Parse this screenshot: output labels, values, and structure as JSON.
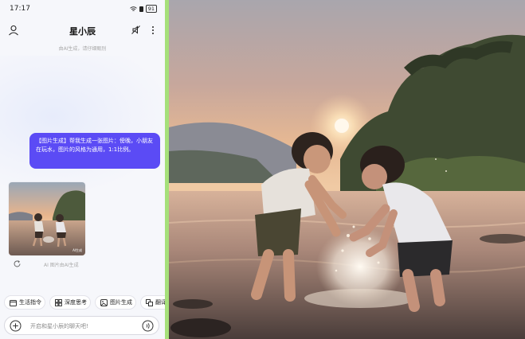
{
  "status_bar": {
    "time": "17:17",
    "battery": "91"
  },
  "header": {
    "title": "星小辰"
  },
  "chat": {
    "disclaimer": "由AI生成，请仔细甄别",
    "user_message": "【图片生成】帮我生成一张图片：傍晚，小朋友在玩水，图片的风格为通用，1:1比例。",
    "image_watermark": "AI生成",
    "ai_note": "AI 图片由AI生成"
  },
  "quick_actions": [
    {
      "label": "生活指令",
      "icon": "calendar-icon"
    },
    {
      "label": "深度思考",
      "icon": "grid-icon"
    },
    {
      "label": "图片生成",
      "icon": "image-icon"
    },
    {
      "label": "翻译",
      "icon": "translate-icon"
    }
  ],
  "composer": {
    "placeholder": "开启和星小辰的聊天吧!"
  },
  "colors": {
    "accent": "#5b4bf5",
    "divider": "#a6e07a",
    "panel_bg": "#f6f7fb"
  }
}
